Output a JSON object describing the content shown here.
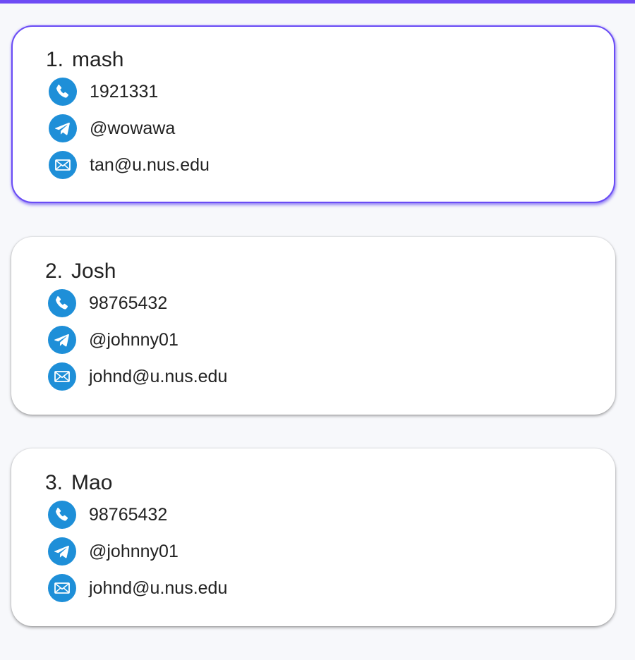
{
  "theme": {
    "accent": "#6e4cf5",
    "icon_blue": "#1e8fd8"
  },
  "contacts": [
    {
      "index": "1.",
      "name": "mash",
      "phone": "1921331",
      "telegram": "@wowawa",
      "email": "tan@u.nus.edu",
      "selected": true
    },
    {
      "index": "2.",
      "name": "Josh",
      "phone": "98765432",
      "telegram": "@johnny01",
      "email": "johnd@u.nus.edu",
      "selected": false
    },
    {
      "index": "3.",
      "name": "Mao",
      "phone": "98765432",
      "telegram": "@johnny01",
      "email": "johnd@u.nus.edu",
      "selected": false
    }
  ],
  "icons": {
    "phone": "phone-icon",
    "telegram": "telegram-icon",
    "email": "email-icon"
  }
}
